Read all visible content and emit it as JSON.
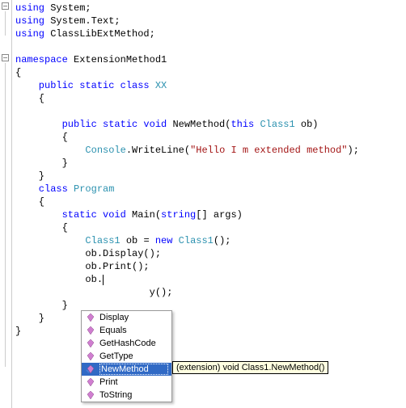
{
  "code": {
    "using1_kw": "using",
    "using1_ns": " System;",
    "using2_kw": "using",
    "using2_ns": " System.Text;",
    "using3_kw": "using",
    "using3_ns": " ClassLibExtMethod;",
    "blank": "",
    "ns_kw": "namespace",
    "ns_name": " ExtensionMethod1",
    "open": "{",
    "cls1_mods": "    public static class ",
    "cls1_name": "XX",
    "cls1_open": "    {",
    "meth1_sig1": "        public static void ",
    "meth1_name": "NewMethod(",
    "meth1_this": "this ",
    "meth1_type": "Class1",
    "meth1_rest": " ob)",
    "meth1_open": "        {",
    "meth1_body1a": "            ",
    "meth1_body1_type": "Console",
    "meth1_body1b": ".WriteLine(",
    "meth1_body1_str": "\"Hello I m extended method\"",
    "meth1_body1c": ");",
    "meth1_close": "        }",
    "cls1_close": "    }",
    "cls2_kw": "    class ",
    "cls2_name": "Program",
    "cls2_open": "    {",
    "main_sig1": "        static void ",
    "main_name": "Main(",
    "main_arg_kw": "string",
    "main_rest": "[] args)",
    "main_open": "        {",
    "main_l1a": "            ",
    "main_l1_type": "Class1",
    "main_l1b": " ob = ",
    "main_l1_new": "new ",
    "main_l1_type2": "Class1",
    "main_l1c": "();",
    "main_l2": "            ob.Display();",
    "main_l3": "            ob.Print();",
    "main_l4": "            ob.",
    "main_l5": "                       y();",
    "main_close": "        }",
    "cls2_close": "    }",
    "ns_close": "}"
  },
  "intellisense": {
    "items": [
      {
        "label": "Display",
        "kind": "method"
      },
      {
        "label": "Equals",
        "kind": "method"
      },
      {
        "label": "GetHashCode",
        "kind": "method"
      },
      {
        "label": "GetType",
        "kind": "method"
      },
      {
        "label": "NewMethod",
        "kind": "extension",
        "selected": true
      },
      {
        "label": "Print",
        "kind": "method"
      },
      {
        "label": "ToString",
        "kind": "method"
      }
    ]
  },
  "tooltip": "(extension) void Class1.NewMethod()"
}
